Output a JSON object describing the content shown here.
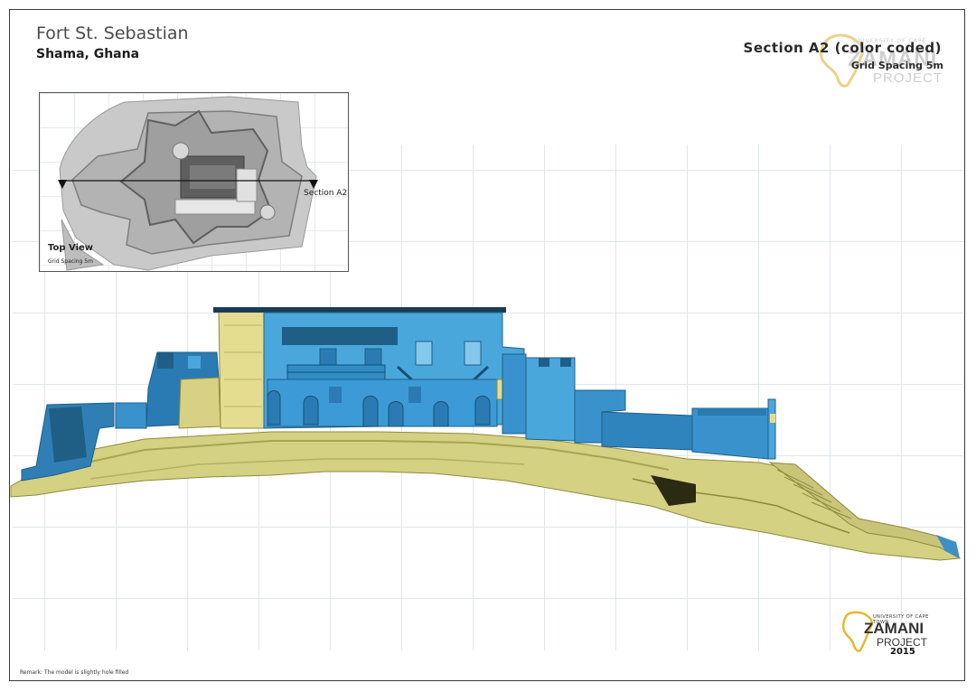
{
  "header": {
    "title": "Fort St. Sebastian",
    "subtitle": "Shama, Ghana"
  },
  "section": {
    "title": "Section A2 (color coded)",
    "grid_spacing": "Grid Spacing 5m"
  },
  "inset": {
    "view_label": "Top View",
    "grid_spacing": "Grid Spacing 5m",
    "section_marker": "Section A2"
  },
  "logo": {
    "university": "UNIVERSITY OF CAPE TOWN",
    "brand": "ZAMANI",
    "project": "PROJECT",
    "year": "2015"
  },
  "footer": {
    "remark": "Remark: The model is slightly hole filled"
  },
  "colors": {
    "section_cut": "#4aa7dc",
    "elevation": "#dcd78a",
    "shadow_blue": "#1f5f86",
    "shadow_yellow": "#8e8a3c"
  }
}
